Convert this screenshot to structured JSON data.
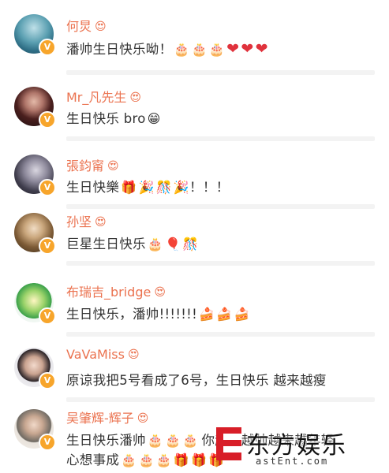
{
  "verified_badge": "V",
  "crown_emoji": "😍",
  "comments": [
    {
      "name": "何炅",
      "text": "潘帅生日快乐呦！",
      "emoji": [
        "cake",
        "cake",
        "cake",
        "heart",
        "heart",
        "heart"
      ]
    },
    {
      "name": "Mr_凡先生",
      "text": "生日快乐 bro",
      "emoji": [
        "grin"
      ]
    },
    {
      "name": "張鈞甯",
      "text": "生日快樂",
      "emoji": [
        "gift",
        "party",
        "fireworks",
        "party"
      ],
      "suffix": "！！！"
    },
    {
      "name": "孙坚",
      "text": "巨星生日快乐",
      "emoji": [
        "cake2",
        "balloon",
        "fireworks"
      ]
    },
    {
      "name": "布瑞吉_bridge",
      "text": "生日快乐，潘帅!!!!!!!",
      "emoji": [
        "cakeslice",
        "cakeslice",
        "cakeslice"
      ]
    },
    {
      "name": "VaVaMiss",
      "text": "原谅我把5号看成了6号，生日快乐 越来越瘦",
      "emoji": []
    },
    {
      "name": "吴肇辉-辉子",
      "text": "生日快乐潘帅",
      "emoji": [
        "cake",
        "cake",
        "cake"
      ],
      "text2": "你越来越帅越来越年轻",
      "line2": "心想事成",
      "emoji2": [
        "cake",
        "cake",
        "cake",
        "gift2",
        "gift2",
        "gift2"
      ]
    }
  ],
  "watermark": {
    "title": "东方娱乐",
    "subtitle": "astEnt.com"
  },
  "colors": {
    "name": "#eb7350",
    "text": "#333333",
    "badge": "#f7a52b",
    "heart": "#e0323c",
    "watermark": "#d81e28"
  }
}
